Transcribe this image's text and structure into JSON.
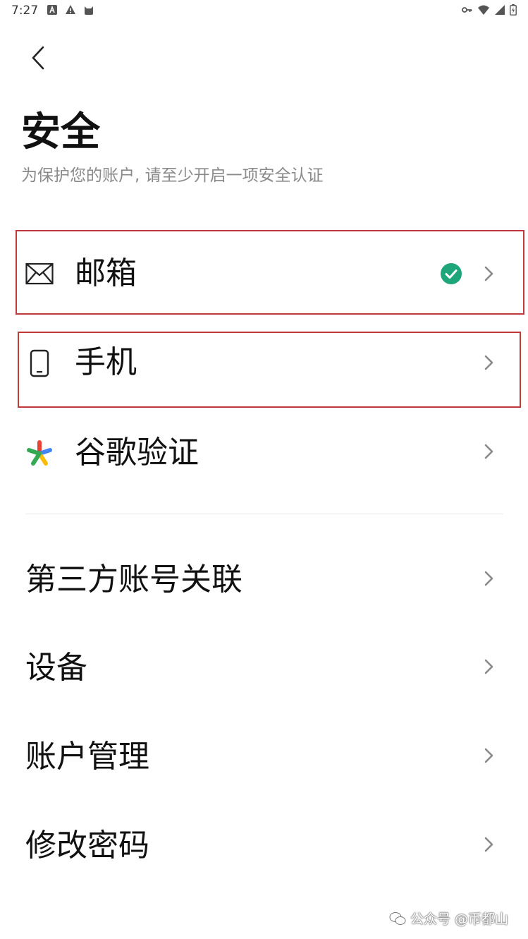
{
  "status_bar": {
    "time": "7:27",
    "left_icons": [
      "font-icon",
      "warning-icon",
      "cat-icon"
    ],
    "right_icons": [
      "vpn-key-icon",
      "wifi-icon",
      "signal-icon",
      "battery-icon"
    ]
  },
  "header": {
    "title": "安全",
    "subtitle": "为保护您的账户, 请至少开启一项安全认证"
  },
  "auth_items": [
    {
      "label": "邮箱",
      "icon": "mail-icon",
      "verified": true
    },
    {
      "label": "手机",
      "icon": "phone-icon",
      "verified": false
    },
    {
      "label": "谷歌验证",
      "icon": "google-authenticator-icon",
      "verified": false
    }
  ],
  "settings_items": [
    {
      "label": "第三方账号关联"
    },
    {
      "label": "设备"
    },
    {
      "label": "账户管理"
    },
    {
      "label": "修改密码"
    }
  ],
  "colors": {
    "highlight_border": "#c0393b",
    "check_badge": "#1fa57a",
    "chevron": "#8a8a8a"
  },
  "watermark": {
    "text": "公众号 @币都山"
  }
}
